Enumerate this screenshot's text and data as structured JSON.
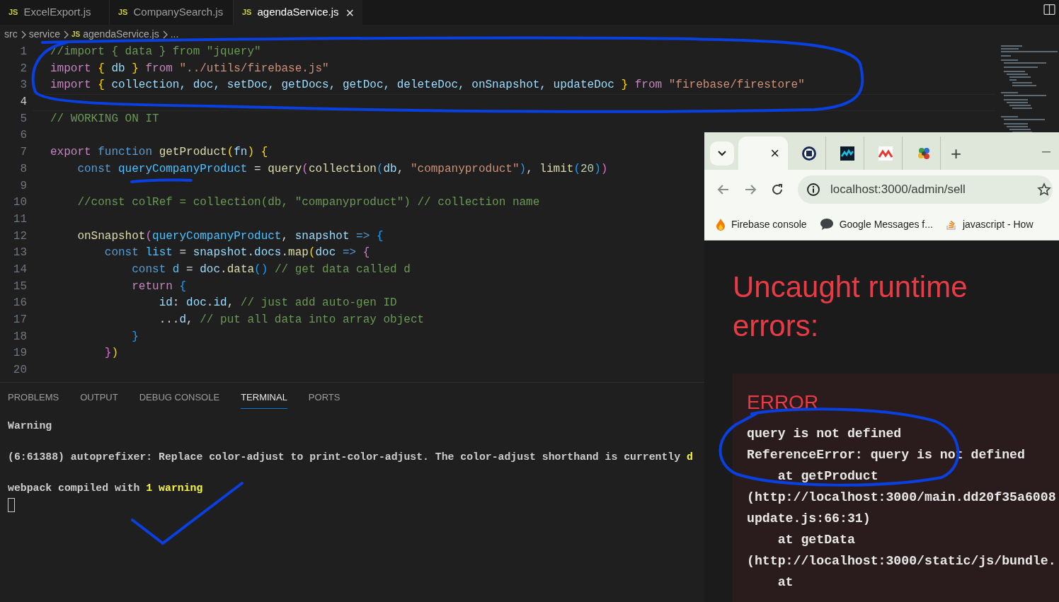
{
  "editor_tabs": [
    {
      "badge": "JS",
      "label": "ExcelExport.js",
      "selected": false
    },
    {
      "badge": "JS",
      "label": "CompanySearch.js",
      "selected": false
    },
    {
      "badge": "JS",
      "label": "agendaService.js",
      "selected": true,
      "close": "×"
    }
  ],
  "breadcrumb": [
    {
      "text": "src"
    },
    {
      "text": "service"
    },
    {
      "badge": "JS",
      "text": "agendaService.js"
    },
    {
      "text": "..."
    }
  ],
  "code_lines": [
    {
      "number": "1",
      "current": false,
      "tokens": [
        {
          "text": "//import { data } from \"jquery\"",
          "kind": "comment"
        }
      ]
    },
    {
      "number": "2",
      "current": false,
      "tokens": [
        {
          "text": "import ",
          "kind": "control"
        },
        {
          "text": "{",
          "kind": "bracket1"
        },
        {
          "text": " db ",
          "kind": "variable"
        },
        {
          "text": "} ",
          "kind": "bracket1"
        },
        {
          "text": "from ",
          "kind": "control"
        },
        {
          "text": "\"../utils/firebase.js\"",
          "kind": "string"
        }
      ]
    },
    {
      "number": "3",
      "current": false,
      "tokens": [
        {
          "text": "import ",
          "kind": "control"
        },
        {
          "text": "{",
          "kind": "bracket1"
        },
        {
          "text": " collection, doc, setDoc, getDocs, getDoc, deleteDoc, onSnapshot, updateDoc ",
          "kind": "variable"
        },
        {
          "text": "} ",
          "kind": "bracket1"
        },
        {
          "text": "from ",
          "kind": "control"
        },
        {
          "text": "\"firebase/firestore\"",
          "kind": "string"
        }
      ]
    },
    {
      "number": "4",
      "current": true
    },
    {
      "number": "5",
      "current": false,
      "tokens": [
        {
          "text": "// WORKING ON IT",
          "kind": "comment"
        }
      ]
    },
    {
      "number": "6",
      "current": false
    },
    {
      "number": "7",
      "current": false,
      "tokens": [
        {
          "text": "export ",
          "kind": "control"
        },
        {
          "text": "function ",
          "kind": "keyword"
        },
        {
          "text": "getProduct",
          "kind": "function"
        },
        {
          "text": "(",
          "kind": "bracket1"
        },
        {
          "text": "fn",
          "kind": "variable"
        },
        {
          "text": ") {",
          "kind": "bracket1"
        }
      ]
    },
    {
      "number": "8",
      "current": false,
      "tokens": [
        {
          "text": "    const ",
          "kind": "keyword"
        },
        {
          "text": "queryCompanyProduct",
          "kind": "constant"
        },
        {
          "text": " = ",
          "kind": "plain"
        },
        {
          "text": "query",
          "kind": "function"
        },
        {
          "text": "(",
          "kind": "bracket2"
        },
        {
          "text": "collection",
          "kind": "function"
        },
        {
          "text": "(",
          "kind": "bracket3"
        },
        {
          "text": "db",
          "kind": "variable"
        },
        {
          "text": ", ",
          "kind": "plain"
        },
        {
          "text": "\"companyproduct\"",
          "kind": "string"
        },
        {
          "text": ")",
          "kind": "bracket3"
        },
        {
          "text": ", ",
          "kind": "plain"
        },
        {
          "text": "limit",
          "kind": "function"
        },
        {
          "text": "(",
          "kind": "bracket3"
        },
        {
          "text": "20",
          "kind": "number"
        },
        {
          "text": ")",
          "kind": "bracket3"
        },
        {
          "text": ")",
          "kind": "bracket2"
        }
      ]
    },
    {
      "number": "9",
      "current": false
    },
    {
      "number": "10",
      "current": false,
      "tokens": [
        {
          "text": "    //const colRef = collection(db, \"companyproduct\") // collection name",
          "kind": "comment"
        }
      ]
    },
    {
      "number": "11",
      "current": false
    },
    {
      "number": "12",
      "current": false,
      "tokens": [
        {
          "text": "    onSnapshot",
          "kind": "function"
        },
        {
          "text": "(",
          "kind": "bracket2"
        },
        {
          "text": "queryCompanyProduct",
          "kind": "constant"
        },
        {
          "text": ", ",
          "kind": "plain"
        },
        {
          "text": "snapshot ",
          "kind": "variable"
        },
        {
          "text": "=> ",
          "kind": "keyword"
        },
        {
          "text": "{",
          "kind": "bracket3"
        }
      ]
    },
    {
      "number": "13",
      "current": false,
      "tokens": [
        {
          "text": "        const ",
          "kind": "keyword"
        },
        {
          "text": "list",
          "kind": "constant"
        },
        {
          "text": " = ",
          "kind": "plain"
        },
        {
          "text": "snapshot",
          "kind": "variable"
        },
        {
          "text": ".",
          "kind": "plain"
        },
        {
          "text": "docs",
          "kind": "variable"
        },
        {
          "text": ".",
          "kind": "plain"
        },
        {
          "text": "map",
          "kind": "function"
        },
        {
          "text": "(",
          "kind": "bracket1"
        },
        {
          "text": "doc ",
          "kind": "variable"
        },
        {
          "text": "=> ",
          "kind": "keyword"
        },
        {
          "text": "{",
          "kind": "bracket2"
        }
      ]
    },
    {
      "number": "14",
      "current": false,
      "tokens": [
        {
          "text": "            const ",
          "kind": "keyword"
        },
        {
          "text": "d",
          "kind": "constant"
        },
        {
          "text": " = ",
          "kind": "plain"
        },
        {
          "text": "doc",
          "kind": "variable"
        },
        {
          "text": ".",
          "kind": "plain"
        },
        {
          "text": "data",
          "kind": "function"
        },
        {
          "text": "() ",
          "kind": "bracket3"
        },
        {
          "text": "// get data called d",
          "kind": "comment"
        }
      ]
    },
    {
      "number": "15",
      "current": false,
      "tokens": [
        {
          "text": "            return ",
          "kind": "control"
        },
        {
          "text": "{",
          "kind": "bracket3"
        }
      ]
    },
    {
      "number": "16",
      "current": false,
      "tokens": [
        {
          "text": "                id",
          "kind": "variable"
        },
        {
          "text": ": ",
          "kind": "plain"
        },
        {
          "text": "doc",
          "kind": "variable"
        },
        {
          "text": ".",
          "kind": "plain"
        },
        {
          "text": "id",
          "kind": "variable"
        },
        {
          "text": ", ",
          "kind": "plain"
        },
        {
          "text": "// just add auto-gen ID",
          "kind": "comment"
        }
      ]
    },
    {
      "number": "17",
      "current": false,
      "tokens": [
        {
          "text": "                ...",
          "kind": "plain"
        },
        {
          "text": "d",
          "kind": "variable"
        },
        {
          "text": ", ",
          "kind": "plain"
        },
        {
          "text": "// put all data into array object",
          "kind": "comment"
        }
      ]
    },
    {
      "number": "18",
      "current": false,
      "tokens": [
        {
          "text": "            }",
          "kind": "bracket3"
        }
      ]
    },
    {
      "number": "19",
      "current": false,
      "tokens": [
        {
          "text": "        }",
          "kind": "bracket2"
        },
        {
          "text": ")",
          "kind": "bracket1"
        }
      ]
    },
    {
      "number": "20",
      "current": false
    }
  ],
  "panel_tabs": [
    {
      "label": "PROBLEMS",
      "selected": false
    },
    {
      "label": "OUTPUT",
      "selected": false
    },
    {
      "label": "DEBUG CONSOLE",
      "selected": false
    },
    {
      "label": "TERMINAL",
      "selected": true
    },
    {
      "label": "PORTS",
      "selected": false
    }
  ],
  "terminal": [
    [
      {
        "text": "Warning",
        "kind": "plain"
      }
    ],
    [
      {
        "text": "(6:61388) autoprefixer: Replace color-adjust to print-color-adjust. The color-adjust shorthand is currently ",
        "kind": "plain"
      },
      {
        "text": "d",
        "kind": "yellow"
      }
    ],
    [
      {
        "text": "webpack compiled with ",
        "kind": "plain"
      },
      {
        "text": "1 warning",
        "kind": "yellow"
      }
    ]
  ],
  "browser": {
    "tabs": [
      {
        "selected": true,
        "close": "×"
      },
      {
        "selected": false
      },
      {
        "selected": false
      },
      {
        "selected": false
      },
      {
        "selected": false
      }
    ],
    "new_tab": "+",
    "address": "localhost:3000/admin/sell",
    "bookmarks": [
      {
        "label": "Firebase console"
      },
      {
        "label": "Google Messages f..."
      },
      {
        "label": "javascript - How"
      }
    ],
    "overlay": {
      "title": "Uncaught runtime errors:",
      "error_label": "ERROR",
      "error_lines": [
        "query is not defined",
        "ReferenceError: query is not defined",
        "    at getProduct",
        "(http://localhost:3000/main.dd20f35a6008",
        "update.js:66:31)",
        "    at getData",
        "(http://localhost:3000/static/js/bundle.",
        "    at"
      ]
    }
  }
}
